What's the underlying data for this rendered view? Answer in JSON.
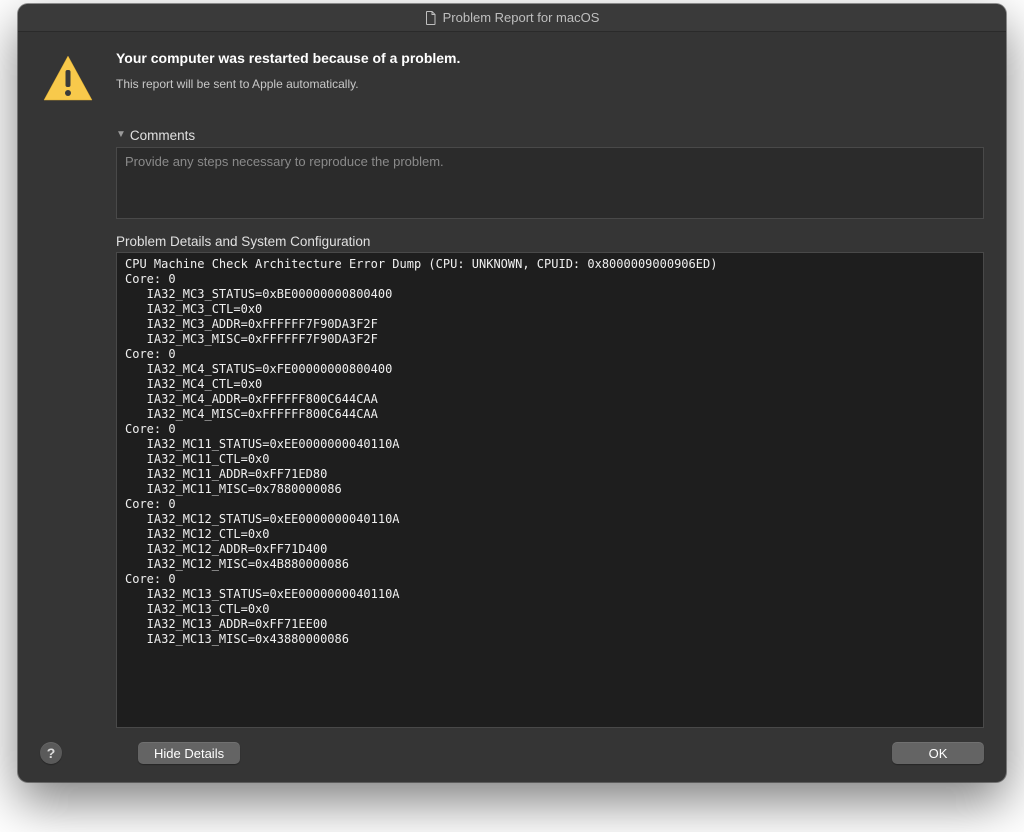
{
  "titlebar": {
    "title": "Problem Report for macOS"
  },
  "header": {
    "heading": "Your computer was restarted because of a problem.",
    "subtext": "This report will be sent to Apple automatically."
  },
  "comments": {
    "label": "Comments",
    "placeholder": "Provide any steps necessary to reproduce the problem."
  },
  "details": {
    "label": "Problem Details and System Configuration",
    "text": "CPU Machine Check Architecture Error Dump (CPU: UNKNOWN, CPUID: 0x8000009000906ED)\nCore: 0\n   IA32_MC3_STATUS=0xBE00000000800400\n   IA32_MC3_CTL=0x0\n   IA32_MC3_ADDR=0xFFFFFF7F90DA3F2F\n   IA32_MC3_MISC=0xFFFFFF7F90DA3F2F\nCore: 0\n   IA32_MC4_STATUS=0xFE00000000800400\n   IA32_MC4_CTL=0x0\n   IA32_MC4_ADDR=0xFFFFFF800C644CAA\n   IA32_MC4_MISC=0xFFFFFF800C644CAA\nCore: 0\n   IA32_MC11_STATUS=0xEE0000000040110A\n   IA32_MC11_CTL=0x0\n   IA32_MC11_ADDR=0xFF71ED80\n   IA32_MC11_MISC=0x7880000086\nCore: 0\n   IA32_MC12_STATUS=0xEE0000000040110A\n   IA32_MC12_CTL=0x0\n   IA32_MC12_ADDR=0xFF71D400\n   IA32_MC12_MISC=0x4B880000086\nCore: 0\n   IA32_MC13_STATUS=0xEE0000000040110A\n   IA32_MC13_CTL=0x0\n   IA32_MC13_ADDR=0xFF71EE00\n   IA32_MC13_MISC=0x43880000086"
  },
  "buttons": {
    "hide_details": "Hide Details",
    "ok": "OK",
    "help_glyph": "?"
  },
  "icons": {
    "warning": "warning-triangle",
    "document": "document"
  }
}
